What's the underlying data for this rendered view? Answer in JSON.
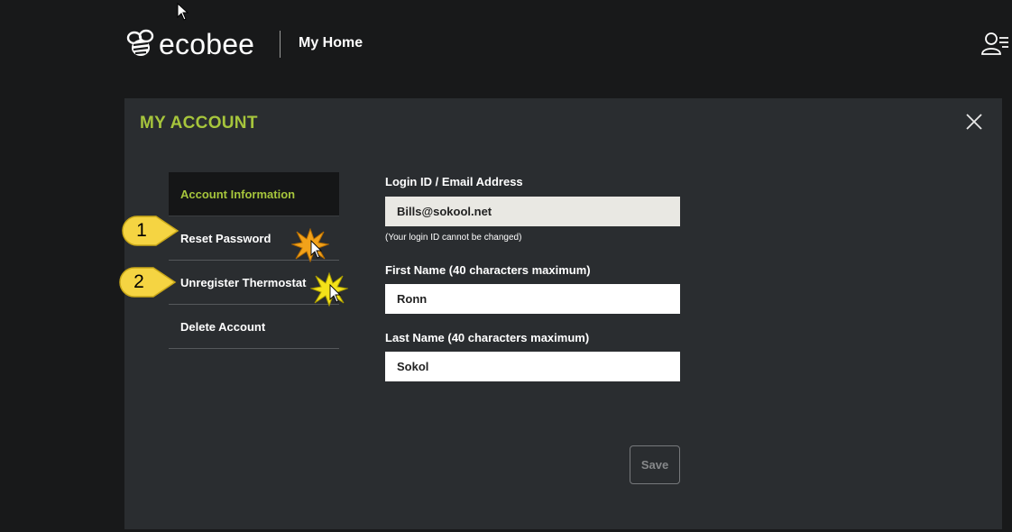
{
  "header": {
    "brand": "ecobee",
    "title": "My Home"
  },
  "panel": {
    "title": "MY ACCOUNT"
  },
  "nav": {
    "items": [
      {
        "label": "Account Information",
        "active": true
      },
      {
        "label": "Reset Password"
      },
      {
        "label": "Unregister Thermostat"
      },
      {
        "label": "Delete Account"
      }
    ]
  },
  "form": {
    "login_label": "Login ID / Email Address",
    "login_value": "Bills@sokool.net",
    "login_note": "(Your login ID cannot be changed)",
    "first_label": "First Name (40 characters maximum)",
    "first_value": "Ronn",
    "last_label": "Last Name (40 characters maximum)",
    "last_value": "Sokol",
    "save_label": "Save"
  },
  "annotations": {
    "callout_1": "1",
    "callout_2": "2"
  },
  "colors": {
    "accent": "#a6c53c",
    "background": "#18191a",
    "panel": "#2a2d30",
    "callout": "#f5d442"
  },
  "icons": [
    "bee-logo-icon",
    "user-menu-icon",
    "close-icon",
    "mouse-pointer-icon",
    "click-burst-icon"
  ]
}
